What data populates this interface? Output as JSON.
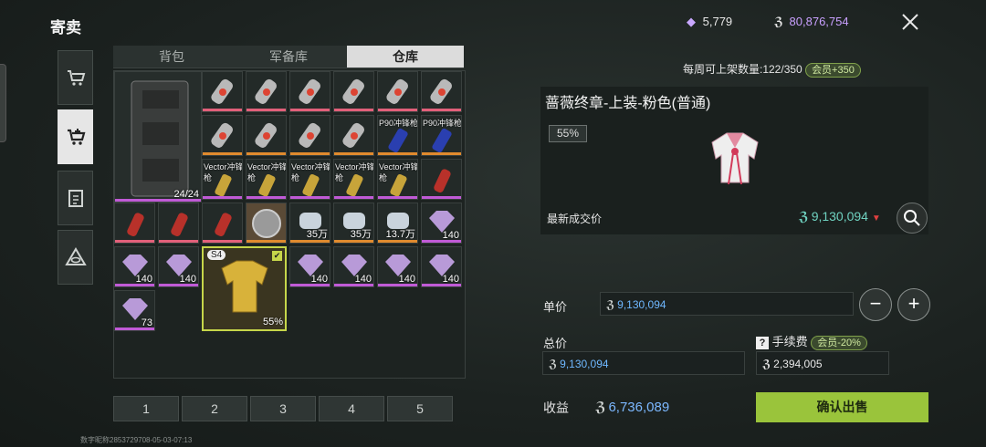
{
  "window": {
    "title": "寄卖"
  },
  "tabs": [
    {
      "label": "背包"
    },
    {
      "label": "军备库"
    },
    {
      "label": "仓库"
    }
  ],
  "pager": [
    "1",
    "2",
    "3",
    "4",
    "5"
  ],
  "footer_note": "数字昵称2853729708-05-03-07:13",
  "currency": {
    "diamonds": "5,779",
    "coins": "80,876,754"
  },
  "weekly": {
    "label": "每周可上架数量:122/350",
    "vip": "会员+350"
  },
  "item": {
    "name": "蔷薇终章-上装-粉色(普通)",
    "durability": "55%",
    "latest_label": "最新成交价",
    "latest_price": "9,130,094"
  },
  "form": {
    "unit_label": "单价",
    "unit_value": "9,130,094",
    "total_label": "总价",
    "total_value": "9,130,094",
    "fee_label": "手续费",
    "fee_vip": "会员-20%",
    "fee_value": "2,394,005",
    "profit_label": "收益",
    "profit_value": "6,736,089",
    "confirm": "确认出售"
  },
  "grid": {
    "case_count": "24/24",
    "labels": {
      "p90": "P90冲锋枪",
      "vector": "Vector冲锋枪"
    },
    "counts": {
      "c35a": "35万",
      "c35b": "35万",
      "c137": "13.7万",
      "d140": "140",
      "d73": "73",
      "s4": "S4",
      "armor_pct": "55%"
    }
  },
  "colors": {
    "accent_green": "#9ac43b",
    "price_teal": "#6fd2c0",
    "value_blue": "#6fb8ff",
    "rarity_purple": "#c05ad6",
    "rarity_orange": "#e08a2e",
    "rarity_pink": "#e2607a"
  }
}
